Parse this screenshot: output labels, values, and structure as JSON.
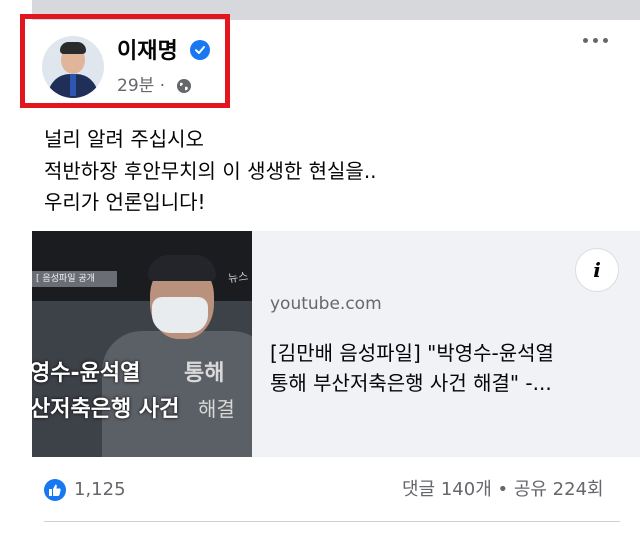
{
  "post": {
    "author": "이재명",
    "time": "29분 ·",
    "lines": [
      "널리 알려 주십시오",
      "적반하장 후안무치의 이 생생한 현실을..",
      "우리가 언론입니다!"
    ]
  },
  "link": {
    "domain": "youtube.com",
    "title_lines": [
      "[김만배 음성파일] \"박영수-윤석열",
      "통해 부산저축은행 사건 해결\" -..."
    ],
    "info_label": "i",
    "thumbnail": {
      "tag": "[ 음성파일 공개",
      "watermark": "뉴스",
      "caption_line1": "영수-윤석열",
      "caption_line1_suffix": "통해",
      "caption_line2": "산저축은행 사건",
      "caption_line2_suffix": "해결"
    }
  },
  "footer": {
    "likes": "1,125",
    "stats": "댓글 140개 • 공유 224회"
  },
  "colors": {
    "highlight_box": "#e3161f",
    "accent": "#1877f2",
    "secondary_text": "#65676b"
  },
  "icons": {
    "verified": "verified-badge-icon",
    "privacy": "globe-icon",
    "menu": "more-options-icon",
    "reaction": "like-icon"
  }
}
